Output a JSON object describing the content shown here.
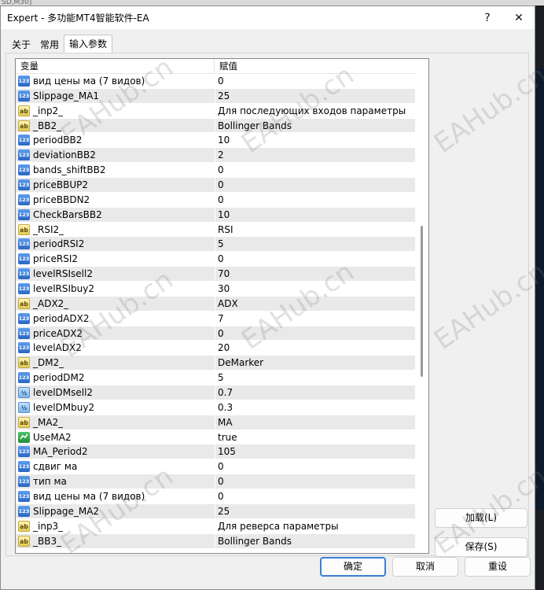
{
  "backdrop_label": "SD,M30]",
  "window": {
    "title": "Expert - 多功能MT4智能软件-EA",
    "help_glyph": "?",
    "close_glyph": "✕"
  },
  "tabs": [
    {
      "label": "关于"
    },
    {
      "label": "常用"
    },
    {
      "label": "输入参数"
    }
  ],
  "grid": {
    "headers": [
      "变量",
      "赋值"
    ],
    "rows": [
      {
        "type": "int",
        "name": "вид цены ма (7 видов)",
        "value": "0"
      },
      {
        "type": "int",
        "name": "Slippage_MA1",
        "value": "25"
      },
      {
        "type": "str",
        "name": "_inp2_",
        "value": "Для последующих входов параметры"
      },
      {
        "type": "str",
        "name": "_BB2_",
        "value": "Bollinger Bands"
      },
      {
        "type": "int",
        "name": "periodBB2",
        "value": "10"
      },
      {
        "type": "int",
        "name": "deviationBB2",
        "value": "2"
      },
      {
        "type": "int",
        "name": "bands_shiftBB2",
        "value": "0"
      },
      {
        "type": "int",
        "name": "priceBBUP2",
        "value": "0"
      },
      {
        "type": "int",
        "name": "priceBBDN2",
        "value": "0"
      },
      {
        "type": "int",
        "name": "CheckBarsBB2",
        "value": "10"
      },
      {
        "type": "str",
        "name": "_RSI2_",
        "value": "RSI"
      },
      {
        "type": "int",
        "name": "periodRSI2",
        "value": "5"
      },
      {
        "type": "int",
        "name": "priceRSI2",
        "value": "0"
      },
      {
        "type": "int",
        "name": "levelRSIsell2",
        "value": "70"
      },
      {
        "type": "int",
        "name": "levelRSIbuy2",
        "value": "30"
      },
      {
        "type": "str",
        "name": "_ADX2_",
        "value": "ADX"
      },
      {
        "type": "int",
        "name": "periodADX2",
        "value": "7"
      },
      {
        "type": "int",
        "name": "priceADX2",
        "value": "0"
      },
      {
        "type": "int",
        "name": "levelADX2",
        "value": "20"
      },
      {
        "type": "str",
        "name": "_DM2_",
        "value": "DeMarker"
      },
      {
        "type": "int",
        "name": "periodDM2",
        "value": "5"
      },
      {
        "type": "dbl",
        "name": "levelDMsell2",
        "value": "0.7"
      },
      {
        "type": "dbl",
        "name": "levelDMbuy2",
        "value": "0.3"
      },
      {
        "type": "str",
        "name": "_MA2_",
        "value": "MA"
      },
      {
        "type": "bool",
        "name": "UseMA2",
        "value": "true"
      },
      {
        "type": "int",
        "name": "MA_Period2",
        "value": "105"
      },
      {
        "type": "int",
        "name": "сдвиг ма",
        "value": "0"
      },
      {
        "type": "int",
        "name": "тип ма",
        "value": "0"
      },
      {
        "type": "int",
        "name": "вид цены ма (7 видов)",
        "value": "0"
      },
      {
        "type": "int",
        "name": "Slippage_MA2",
        "value": "25"
      },
      {
        "type": "str",
        "name": "_inp3_",
        "value": "Для реверса параметры"
      },
      {
        "type": "str",
        "name": "_BB3_",
        "value": "Bollinger Bands"
      }
    ]
  },
  "icon_glyphs": {
    "int": "123",
    "str": "ab",
    "dbl": "½"
  },
  "side_buttons": {
    "load": "加载(L)",
    "save": "保存(S)"
  },
  "footer_buttons": {
    "ok": "确定",
    "cancel": "取消",
    "reset": "重设"
  },
  "watermark": "EAHub.cn"
}
